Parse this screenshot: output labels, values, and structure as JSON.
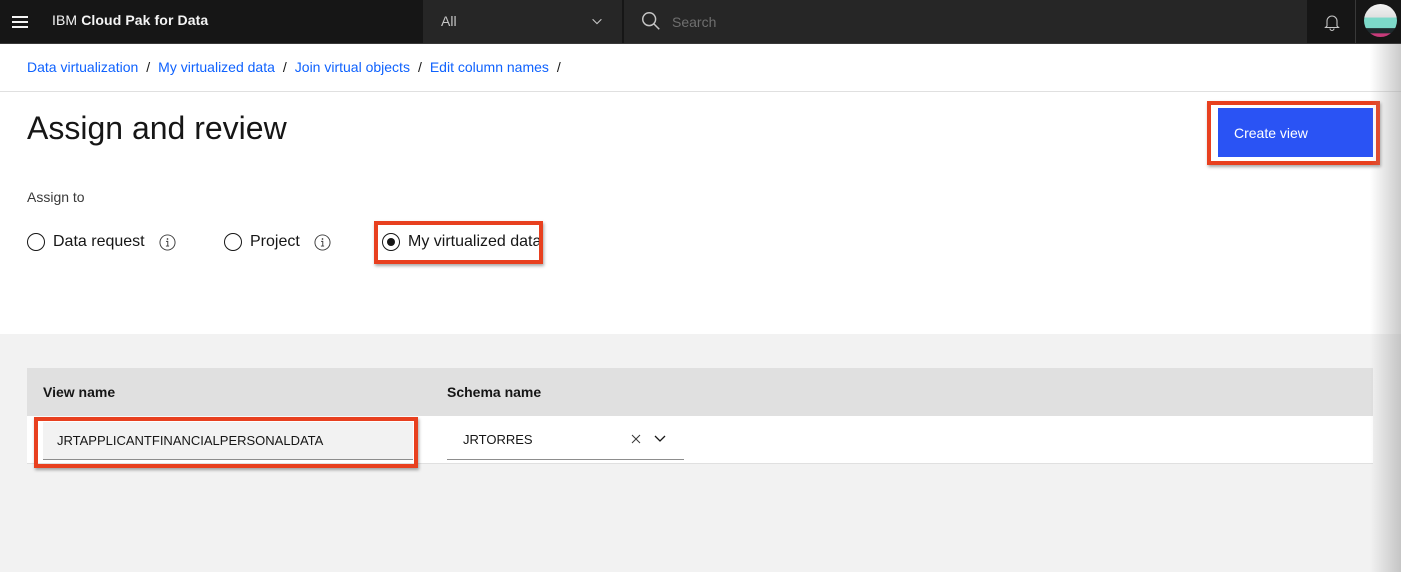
{
  "header": {
    "brand_prefix": "IBM",
    "brand_name": "Cloud Pak for Data",
    "scope_selected": "All",
    "search_placeholder": "Search"
  },
  "breadcrumb": [
    {
      "label": "Data virtualization"
    },
    {
      "label": "My virtualized data"
    },
    {
      "label": "Join virtual objects"
    },
    {
      "label": "Edit column names"
    }
  ],
  "breadcrumb_separator": "/",
  "page": {
    "title": "Assign and review",
    "create_button": "Create view"
  },
  "assign": {
    "label": "Assign to",
    "options": [
      {
        "label": "Data request",
        "checked": false,
        "has_info": true
      },
      {
        "label": "Project",
        "checked": false,
        "has_info": true
      },
      {
        "label": "My virtualized data",
        "checked": true,
        "has_info": false
      }
    ]
  },
  "table": {
    "columns": [
      "View name",
      "Schema name"
    ],
    "rows": [
      {
        "view_name": "JRTAPPLICANTFINANCIALPERSONALDATA",
        "schema_name": "JRTORRES"
      }
    ]
  },
  "colors": {
    "primary_button": "#2a53f4",
    "link": "#0f62fe",
    "highlight_outline": "#e8401f",
    "header_bg": "#161616"
  }
}
